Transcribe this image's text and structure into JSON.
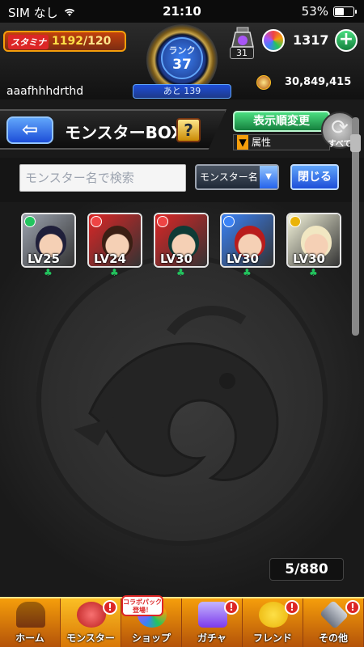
{
  "status_bar": {
    "carrier": "SIM なし",
    "time": "21:10",
    "battery": "53%",
    "battery_level": 0.53
  },
  "header": {
    "stamina_label": "スタミナ",
    "stamina_current": "1192",
    "stamina_max": "/120",
    "rank_label": "ランク",
    "rank_value": "37",
    "rank_remaining": "あと 139",
    "lab_count": "31",
    "orb_count": "1317",
    "username": "aaafhhhdrthd",
    "gold": "30,849,415"
  },
  "title_bar": {
    "back_label": "⇦",
    "title": "モンスターBOX",
    "help_label": "?",
    "sort_label": "表示順変更",
    "attribute_label": "属性",
    "all_label": "すべて"
  },
  "search": {
    "placeholder": "モンスター名で検索",
    "select_value": "モンスター名",
    "close_label": "閉じる"
  },
  "monsters": [
    {
      "level": "LV25",
      "element": "green",
      "bg": "#9ca3af",
      "hair": "#1f1f3a"
    },
    {
      "level": "LV24",
      "element": "red",
      "bg": "#dc2626",
      "hair": "#3b1f14"
    },
    {
      "level": "LV30",
      "element": "red",
      "bg": "#dc2626",
      "hair": "#0f3b36"
    },
    {
      "level": "LV30",
      "element": "blue",
      "bg": "#3b82f6",
      "hair": "#b91c1c"
    },
    {
      "level": "LV30",
      "element": "yellow",
      "bg": "#f5f5dc",
      "hair": "#f1e7c2"
    }
  ],
  "box_count": "5/880",
  "nav": {
    "items": [
      {
        "label": "ホーム",
        "badge": ""
      },
      {
        "label": "モンスター",
        "badge": "!"
      },
      {
        "label": "ショップ",
        "badge": ""
      },
      {
        "label": "ガチャ",
        "badge": "!"
      },
      {
        "label": "フレンド",
        "badge": "!"
      },
      {
        "label": "その他",
        "badge": "!"
      }
    ],
    "collab_tag": "コラボパック登場！"
  },
  "colors": {
    "accent": "#f59e0b",
    "primary_blue": "#1d4ed8",
    "green": "#15803d"
  }
}
